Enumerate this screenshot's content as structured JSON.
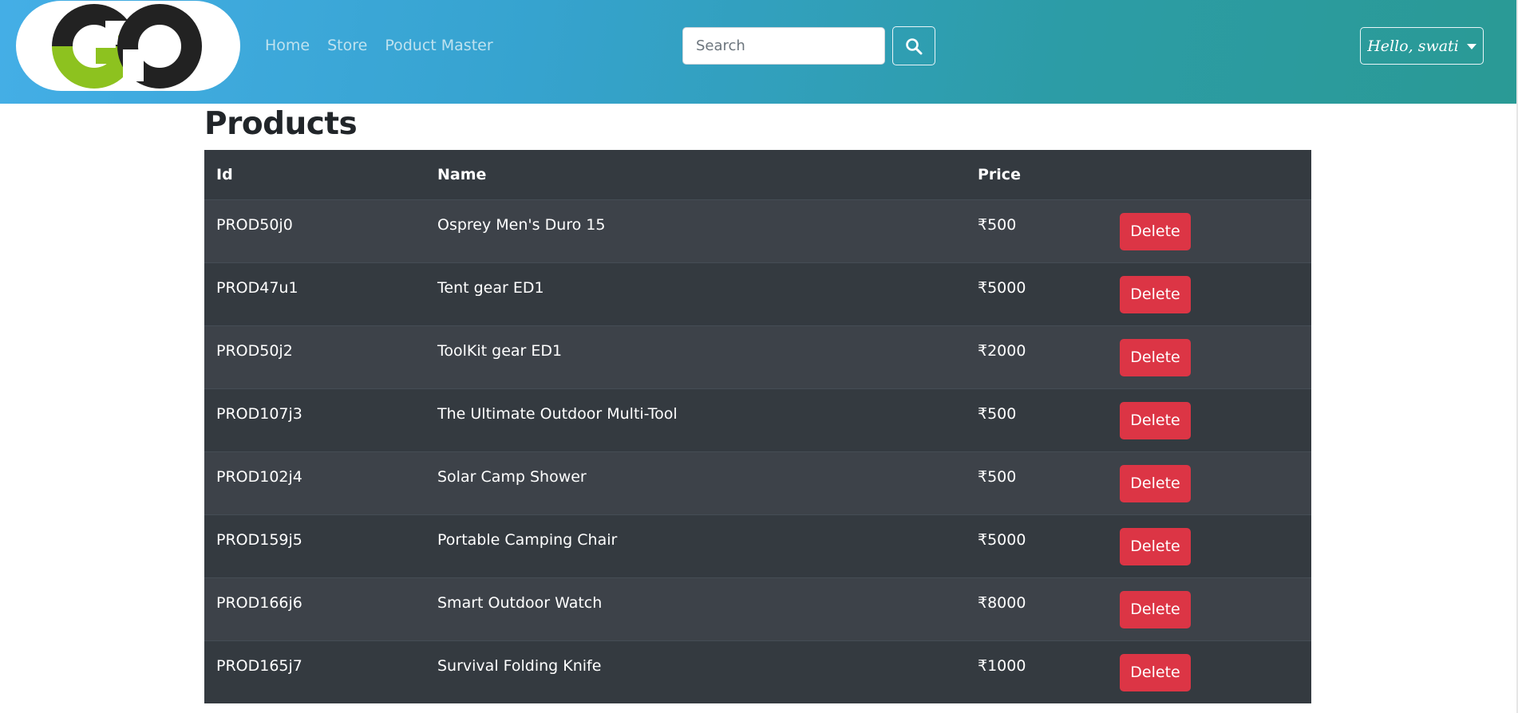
{
  "navbar": {
    "logo_text": "GO",
    "links": [
      "Home",
      "Store",
      "Poduct Master"
    ],
    "search": {
      "placeholder": "Search",
      "value": ""
    },
    "search_icon": "search-icon",
    "user_greeting": "Hello, swati",
    "user_caret_icon": "caret-down-icon"
  },
  "page": {
    "title": "Products"
  },
  "table": {
    "columns": [
      "Id",
      "Name",
      "Price",
      ""
    ],
    "rows": [
      {
        "id": "PROD50j0",
        "name": "Osprey Men's Duro 15",
        "price": "₹500",
        "action": "Delete"
      },
      {
        "id": "PROD47u1",
        "name": "Tent gear ED1",
        "price": "₹5000",
        "action": "Delete"
      },
      {
        "id": "PROD50j2",
        "name": "ToolKit gear ED1",
        "price": "₹2000",
        "action": "Delete"
      },
      {
        "id": "PROD107j3",
        "name": "The Ultimate Outdoor Multi-Tool",
        "price": "₹500",
        "action": "Delete"
      },
      {
        "id": "PROD102j4",
        "name": "Solar Camp Shower",
        "price": "₹500",
        "action": "Delete"
      },
      {
        "id": "PROD159j5",
        "name": "Portable Camping Chair",
        "price": "₹5000",
        "action": "Delete"
      },
      {
        "id": "PROD166j6",
        "name": "Smart Outdoor Watch",
        "price": "₹8000",
        "action": "Delete"
      },
      {
        "id": "PROD165j7",
        "name": "Survival Folding Knife",
        "price": "₹1000",
        "action": "Delete"
      }
    ]
  },
  "colors": {
    "navbar_gradient_start": "#44aee6",
    "navbar_gradient_end": "#2a9a95",
    "logo_dark": "#222222",
    "logo_green": "#8dc21f",
    "table_dark": "#343a40",
    "table_stripe": "#3d4249",
    "delete_red": "#dc3545"
  }
}
